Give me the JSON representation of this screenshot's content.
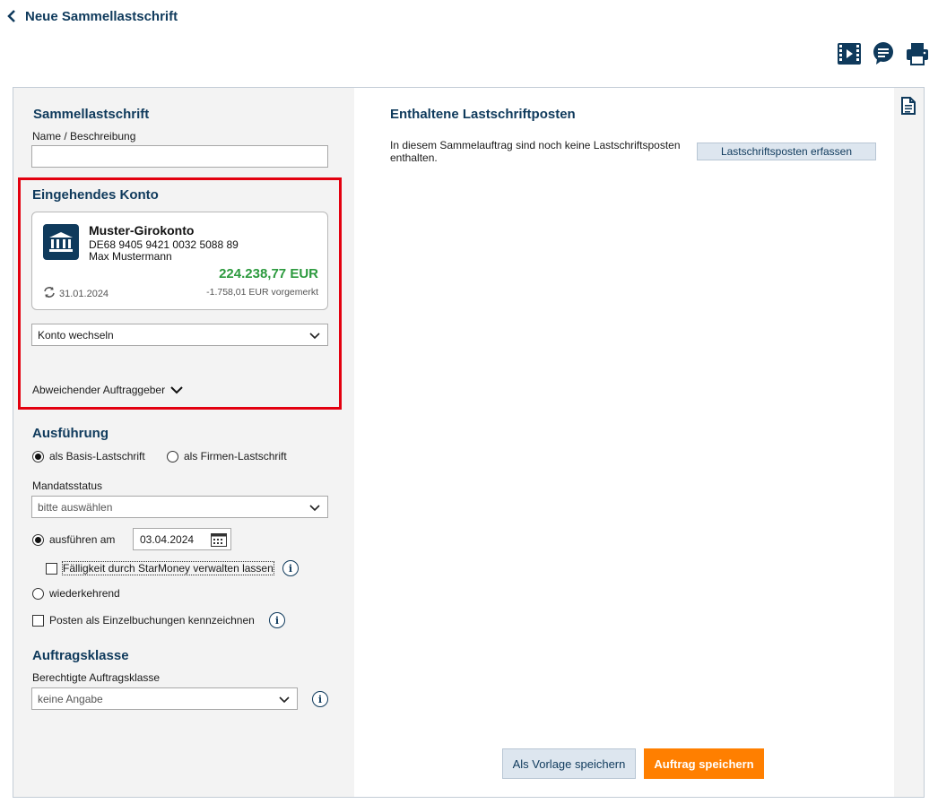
{
  "header": {
    "title": "Neue Sammellastschrift"
  },
  "toolbar": {
    "icons": [
      "video-icon",
      "chat-icon",
      "print-icon"
    ]
  },
  "form": {
    "section_title": "Sammellastschrift",
    "name_label": "Name / Beschreibung",
    "name_value": ""
  },
  "account": {
    "section_title": "Eingehendes Konto",
    "name": "Muster-Girokonto",
    "iban": "DE68 9405 9421 0032 5088 89",
    "owner": "Max Mustermann",
    "balance": "224.238,77 EUR",
    "date": "31.01.2024",
    "pending": "-1.758,01 EUR vorgemerkt",
    "switch_label": "Konto wechseln",
    "alt_payer_label": "Abweichender Auftraggeber"
  },
  "execution": {
    "section_title": "Ausführung",
    "radio_basis": "als Basis-Lastschrift",
    "radio_firmen": "als Firmen-Lastschrift",
    "mandate_label": "Mandatsstatus",
    "mandate_value": "bitte auswählen",
    "execute_on_label": "ausführen am",
    "execute_date": "03.04.2024",
    "starmoney_label": "Fälligkeit durch StarMoney verwalten lassen",
    "recurring_label": "wiederkehrend",
    "single_posting_label": "Posten als Einzelbuchungen kennzeichnen"
  },
  "order_class": {
    "section_title": "Auftragsklasse",
    "label": "Berechtigte Auftragsklasse",
    "value": "keine Angabe"
  },
  "main": {
    "title": "Enthaltene Lastschriftposten",
    "empty_text": "In diesem Sammelauftrag sind noch keine Lastschriftsposten enthalten.",
    "add_button": "Lastschriftsposten erfassen",
    "save_template_button": "Als Vorlage speichern",
    "save_order_button": "Auftrag speichern"
  },
  "colors": {
    "brand": "#0f3a5c",
    "positive": "#2c9a3e",
    "accent": "#ff7f00",
    "highlight": "#e3000f"
  }
}
